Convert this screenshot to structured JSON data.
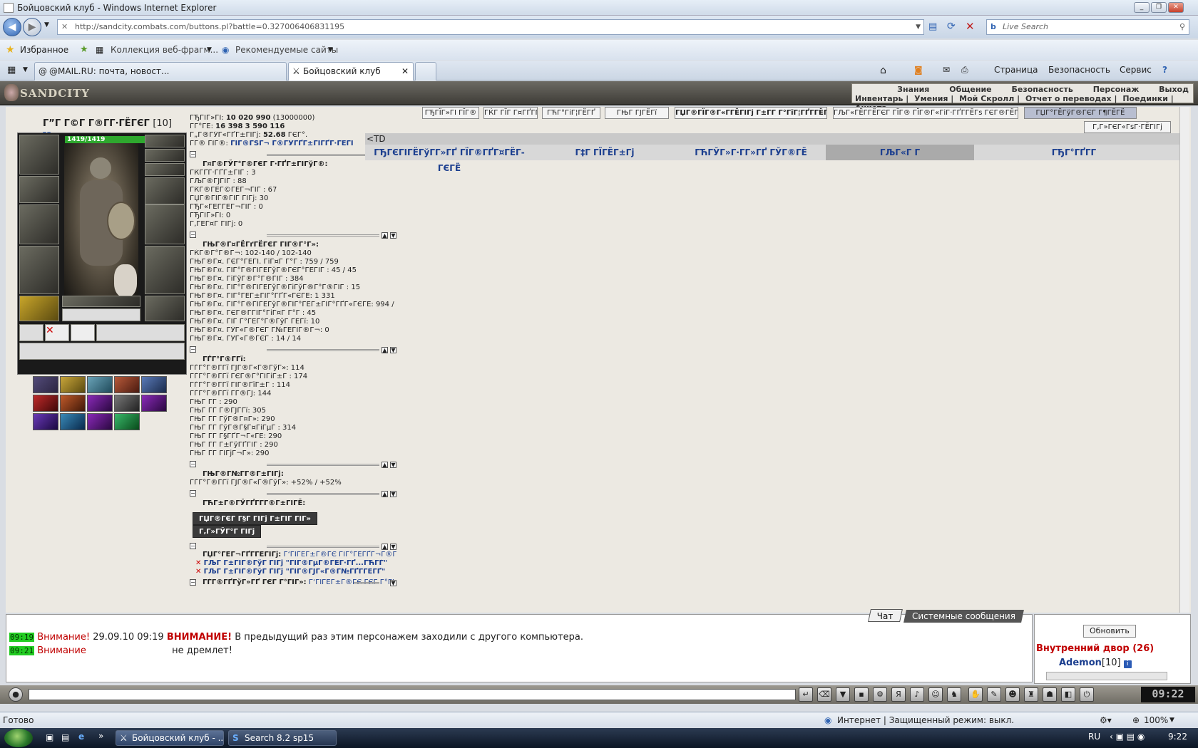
{
  "window": {
    "title": "Бойцовский клуб - Windows Internet Explorer"
  },
  "browser": {
    "url": "http://sandcity.combats.com/buttons.pl?battle=0.327006406831195",
    "search_placeholder": "Live Search",
    "favorites_label": "Избранное",
    "fav_links": [
      "Коллекция веб-фрагм...",
      "Рекомендуемые сайты"
    ],
    "tabs": [
      "@MAIL.RU: почта, новост...",
      "Бойцовский клуб"
    ],
    "commands": [
      "Страница",
      "Безопасность",
      "Сервис"
    ]
  },
  "game": {
    "logo": "SANDCITY",
    "menu_top": [
      "Знания",
      "Общение",
      "Безопасность",
      "Персонаж",
      "Выход"
    ],
    "menu_bottom": [
      "Инвентарь",
      "Умения",
      "Мой Скролл",
      "Отчет о переводах",
      "Поединки",
      "Анкета"
    ],
    "char_name": "Г”Г Г©Г Г®ГГ·ГЁГЄГ",
    "char_level": "[10]",
    "hp": "1419/1419",
    "stats_head": [
      {
        "l": "ГЂГЇГ»ГІ:",
        "v": "10 020 990",
        "x": "(13000000)"
      },
      {
        "l": "ГГ°ГЁ:",
        "v": "16 398",
        "x": "3 590   116"
      },
      {
        "l": "Г„Г®ГЎГ«ГҐГ±ГІГј:",
        "v": "52.68",
        "x": "ГЄГ°."
      },
      {
        "l": "ГГ® ГЇГ®:",
        "v": "ГЇГ®ГЅГ¬ Г®ГЎГҐГ±ГЇГҐГ·ГЁГЇ",
        "x": ""
      }
    ],
    "section1": {
      "title": "Г¤Г®ГЎГ°Г®ГЄГ Г·ГҐГ±ГІГўГ®:",
      "rows": [
        "ГЌГҐГ·ГҐГ±ГЇГ : 3",
        "ГЉГ®ГЈГЇГ : 88",
        "ГЌГ®ГЁГ©ГЁГ¬ГЇГ : 67",
        "ГЏГ®ГЇГ®ГЇГ ГІГј: 30",
        "ГЂГ«ГЁГ­ГЁГ¬ГЇГ : 0",
        "ГЂГЇГ»ГІ: 0",
        "Г‚ГЁГ¤Г ГІГј: 0"
      ]
    },
    "section2": {
      "title": "ГЊГ®Г¤ГЁГґГЁГЄГ ГІГ®Г°Г»:",
      "rows": [
        "ГЌГ®Г°Г®Г¬: 102-140 / 102-140",
        "ГЊГ®Г¤. ГЄГ°ГЁГІ. ГіГ¤Г Г°Г : 759 / 759",
        "ГЊГ®Г¤. ГЇГ°Г®ГІГЁГўГ®ГЄГ°ГЁГІГ : 45 / 45",
        "ГЊГ®Г¤. ГіГўГ®Г°Г®ГІГ : 384",
        "ГЊГ®Г¤. ГЇГ°Г®ГІГЁГўГ®ГіГўГ®Г°Г®ГІГ : 15",
        "ГЊГ®Г¤. ГЇГ°ГЁГ±ГІГ°ГҐГ«ГЄГЁ: 1 331",
        "ГЊГ®Г¤. ГЇГ°Г®ГІГЁГўГ®ГЇГ°ГЁГ±ГІГ°ГҐГ«ГЄГЁ: 994 / 994",
        "ГЊГ®Г¤. ГЄГ®Г­ГІГ°ГіГ¤Г Г°Г : 45",
        "ГЊГ®Г¤. ГЇГ Г°ГЁГ°Г®ГўГ ГЁГї: 10",
        "ГЊГ®Г¤. ГЎГ«Г®ГЄГ  Г№ГЁГІГ®Г¬: 0",
        "ГЊГ®Г¤. ГЎГ«Г®ГЄГ : 14 / 14"
      ]
    },
    "section3": {
      "title": "ГЃГ°Г®Г­Гї:",
      "rows": [
        "ГЃГ°Г®Г­Гї ГЈГ®Г«Г®ГўГ»: 114",
        "ГЃГ°Г®Г­Гї ГЄГ®Г°ГЇГіГ±Г : 174",
        "ГЃГ°Г®Г­Гї ГЇГ®ГїГ±Г : 114",
        "ГЃГ°Г®Г­Гї Г­Г®ГЈ: 144",
        "ГЊГ Г­Г : 290",
        "ГЊГ Г­Г  Г®ГЈГ­Гї: 305",
        "ГЊГ Г­Г  ГўГ®Г¤Г»: 290",
        "ГЊГ Г­Г  ГўГ®Г§Г¤ГіГµГ : 314",
        "ГЊГ Г­Г  Г§ГҐГ¬Г«ГЁ: 290",
        "ГЊГ Г­Г  Г±ГўГҐГІГ : 290",
        "ГЊГ Г­Г  ГІГјГ¬Г»: 290"
      ]
    },
    "section4": {
      "title": "ГЊГ®Г№Г­Г®Г±ГІГј:",
      "rows": [
        "ГЃГ°Г®Г­Гї ГЈГ®Г«Г®ГўГ»: +52% / +52%"
      ]
    },
    "section5": {
      "title": "ГЋГ±Г®ГЎГҐГ­Г­Г®Г±ГІГЁ:"
    },
    "dark_buttons": [
      "ГЏГ®ГЄГ Г§Г ГІГј Г±ГІГ ГІГ»",
      "Г‚Г»ГЎГ°Г ГІГј"
    ],
    "section6": {
      "title": "ГЏГ°ГЁГ¬ГҐГ­ГЁГІГј:",
      "sub": "Г‘ГЇГЁГ±Г®ГЄ ГЇГ°ГЁГҐГ¬Г®Гў"
    },
    "effects": [
      "ГЉГ Г±ГІГ®ГўГ ГІГј \"ГЇГ®ГµГ®ГЁГ·ГҐ...ГЋГЃ\"",
      "ГЉГ Г±ГІГ®ГўГ ГІГј \"ГЇГ®ГЈГ«Г®Г№ГҐГ­ГЁГҐ\""
    ],
    "section7": {
      "title": "ГЃГ®ГҐГўГ»ГҐ ГЄГ Г°ГІГ»:",
      "sub": "Г‘ГЇГЁГ±Г®ГЄ ГЄГ Г°ГІ"
    },
    "battle_buttons": [
      "ГЂГЇГ»ГІ ГЇГ®",
      "ГЌГ ГЇГ Г¤ГҐГ­ГЁГҐ",
      "ГЋГ°ГіГ¦ГЁГҐ",
      "ГЊГ ГЈГЁГї",
      "ГЏГ®ГЇГ®Г«Г­ГЁГІГј Г±Г­Г Г°ГїГ¦ГҐГ­ГЁГҐ",
      "ГЉГ«ГЁГ­ГЁГЄГ  ГЇГ® ГЇГ®Г«ГіГ·ГҐГ­ГЁГѕ ГЄГ®ГЁГ­",
      "ГЏГ°ГЁГўГ®ГЄГ Г¶ГЁГЁ",
      "Г‚Г»ГЄГ«ГѕГ·ГЁГІГј"
    ],
    "td_text": "<TD",
    "battle_tabs": [
      "ГЂГЄГІГЁГўГ­Г»ГҐ ГЇГ®ГҐГ¤ГЁГ­ГЄГЁ",
      "Г‡Г ГЇГЁГ±Гј",
      "ГЋГЎГ»Г·Г­Г»ГҐ ГЎГ®ГЁ",
      "ГЉГ«Г Г­",
      "ГЂГ°ГҐГ­Г "
    ]
  },
  "chat": {
    "tabs": [
      "Чат",
      "Системные сообщения"
    ],
    "lines": [
      {
        "time": "09:19",
        "label": "Внимание!",
        "date": "29.09.10 09:19",
        "bold": "ВНИМАНИЕ!",
        "text": "В предыдущий раз этим персонажем заходили с другого компьютера."
      },
      {
        "time": "09:21",
        "label": "Внимание",
        "date": "",
        "bold": "",
        "text": "не дремлет!"
      }
    ]
  },
  "room": {
    "refresh": "Обновить",
    "name": "Внутренний двор (26)",
    "user": "Ademon",
    "user_level": "[10]"
  },
  "clock": "09:22",
  "statusbar": {
    "left": "Готово",
    "zone": "Интернет | Защищенный режим: выкл.",
    "zoom": "100%"
  },
  "taskbar": {
    "tasks": [
      "Бойцовский клуб - ...",
      "Search 8.2 sp15"
    ],
    "lang": "RU",
    "time": "9:22"
  }
}
